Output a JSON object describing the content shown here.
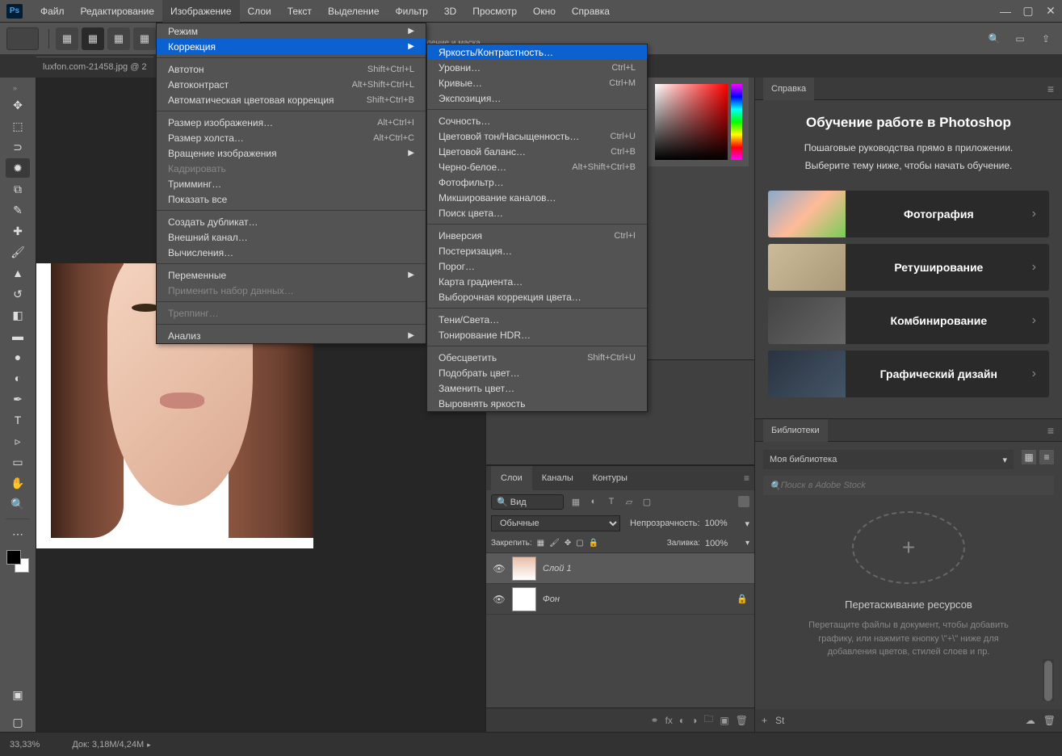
{
  "menubar": [
    "Файл",
    "Редактирование",
    "Изображение",
    "Слои",
    "Текст",
    "Выделение",
    "Фильтр",
    "3D",
    "Просмотр",
    "Окно",
    "Справка"
  ],
  "open_menu_index": 2,
  "doc_tab": "luxfon.com-21458.jpg @ 2",
  "option_hint": "ление и маска…",
  "image_menu": [
    {
      "type": "sub",
      "label": "Режим"
    },
    {
      "type": "sub",
      "label": "Коррекция",
      "hover": true
    },
    {
      "type": "sep"
    },
    {
      "type": "item",
      "label": "Автотон",
      "sc": "Shift+Ctrl+L"
    },
    {
      "type": "item",
      "label": "Автоконтраст",
      "sc": "Alt+Shift+Ctrl+L"
    },
    {
      "type": "item",
      "label": "Автоматическая цветовая коррекция",
      "sc": "Shift+Ctrl+B"
    },
    {
      "type": "sep"
    },
    {
      "type": "item",
      "label": "Размер изображения…",
      "sc": "Alt+Ctrl+I"
    },
    {
      "type": "item",
      "label": "Размер холста…",
      "sc": "Alt+Ctrl+C"
    },
    {
      "type": "sub",
      "label": "Вращение изображения"
    },
    {
      "type": "item",
      "label": "Кадрировать",
      "disabled": true
    },
    {
      "type": "item",
      "label": "Тримминг…"
    },
    {
      "type": "item",
      "label": "Показать все"
    },
    {
      "type": "sep"
    },
    {
      "type": "item",
      "label": "Создать дубликат…"
    },
    {
      "type": "item",
      "label": "Внешний канал…"
    },
    {
      "type": "item",
      "label": "Вычисления…"
    },
    {
      "type": "sep"
    },
    {
      "type": "sub",
      "label": "Переменные"
    },
    {
      "type": "item",
      "label": "Применить набор данных…",
      "disabled": true
    },
    {
      "type": "sep"
    },
    {
      "type": "item",
      "label": "Треппинг…",
      "disabled": true
    },
    {
      "type": "sep"
    },
    {
      "type": "sub",
      "label": "Анализ"
    }
  ],
  "correction_submenu": [
    {
      "label": "Яркость/Контрастность…",
      "hover": true
    },
    {
      "label": "Уровни…",
      "sc": "Ctrl+L"
    },
    {
      "label": "Кривые…",
      "sc": "Ctrl+M"
    },
    {
      "label": "Экспозиция…"
    },
    {
      "type": "sep"
    },
    {
      "label": "Сочность…"
    },
    {
      "label": "Цветовой тон/Насыщенность…",
      "sc": "Ctrl+U"
    },
    {
      "label": "Цветовой баланс…",
      "sc": "Ctrl+B"
    },
    {
      "label": "Черно-белое…",
      "sc": "Alt+Shift+Ctrl+B"
    },
    {
      "label": "Фотофильтр…"
    },
    {
      "label": "Микширование каналов…"
    },
    {
      "label": "Поиск цвета…"
    },
    {
      "type": "sep"
    },
    {
      "label": "Инверсия",
      "sc": "Ctrl+I"
    },
    {
      "label": "Постеризация…"
    },
    {
      "label": "Порог…"
    },
    {
      "label": "Карта градиента…"
    },
    {
      "label": "Выборочная коррекция цвета…"
    },
    {
      "type": "sep"
    },
    {
      "label": "Тени/Света…"
    },
    {
      "label": "Тонирование HDR…"
    },
    {
      "type": "sep"
    },
    {
      "label": "Обесцветить",
      "sc": "Shift+Ctrl+U"
    },
    {
      "label": "Подобрать цвет…"
    },
    {
      "label": "Заменить цвет…"
    },
    {
      "label": "Выровнять яркость"
    }
  ],
  "help_panel": {
    "tab": "Справка",
    "title": "Обучение работе в Photoshop",
    "line1": "Пошаговые руководства прямо в приложении.",
    "line2": "Выберите тему ниже, чтобы начать обучение.",
    "cards": [
      "Фотография",
      "Ретуширование",
      "Комбинирование",
      "Графический дизайн"
    ]
  },
  "layers": {
    "tabs": [
      "Слои",
      "Каналы",
      "Контуры"
    ],
    "search_label": "Вид",
    "blend": "Обычные",
    "opacity_label": "Непрозрачность:",
    "opacity_val": "100%",
    "lock_label": "Закрепить:",
    "fill_label": "Заливка:",
    "fill_val": "100%",
    "rows": [
      {
        "name": "Слой 1",
        "sel": true
      },
      {
        "name": "Фон",
        "locked": true
      }
    ]
  },
  "libraries": {
    "tab": "Библиотеки",
    "select": "Моя библиотека",
    "search_ph": "Поиск в Adobe Stock",
    "title": "Перетаскивание ресурсов",
    "desc": "Перетащите файлы в документ, чтобы добавить графику, или нажмите кнопку \\\"+\\\" ниже для добавления цветов, стилей слоев и пр."
  },
  "status": {
    "zoom": "33,33%",
    "doc": "Док: 3,18M/4,24M"
  }
}
